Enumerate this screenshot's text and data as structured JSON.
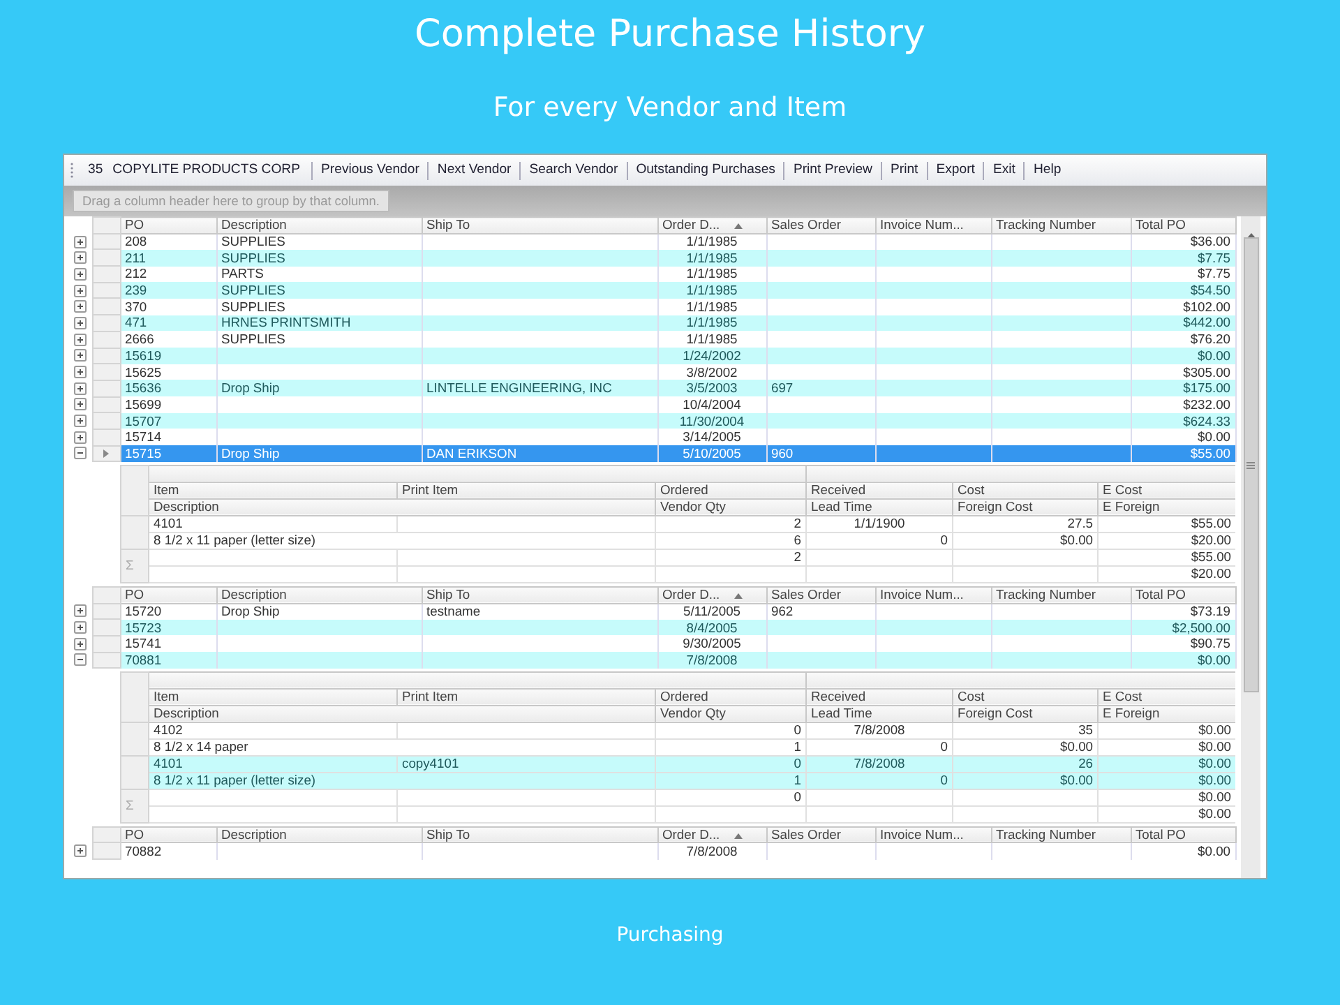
{
  "slide": {
    "title": "Complete Purchase History",
    "subtitle": "For every Vendor and Item",
    "footer": "Purchasing"
  },
  "toolbar": {
    "vendor_number": "35",
    "vendor_name": "COPYLITE PRODUCTS CORP",
    "buttons": [
      "Previous Vendor",
      "Next Vendor",
      "Search Vendor",
      "Outstanding Purchases",
      "Print Preview",
      "Print",
      "Export",
      "Exit",
      "Help"
    ]
  },
  "group_panel": {
    "placeholder": "Drag a column header here to group by that column."
  },
  "grid": {
    "blocks": [
      {
        "kind": "header",
        "columns": [
          {
            "label": "PO"
          },
          {
            "label": "Description"
          },
          {
            "label": "Ship To"
          },
          {
            "label": "Order D...",
            "sorted": true
          },
          {
            "label": "Sales Order"
          },
          {
            "label": "Invoice Num..."
          },
          {
            "label": "Tracking Number"
          },
          {
            "label": "Total PO"
          }
        ]
      },
      {
        "kind": "po",
        "po": "208",
        "description": "SUPPLIES",
        "order_date": "1/1/1985",
        "total": "$36.00",
        "expanded": false,
        "selected": false
      },
      {
        "kind": "po",
        "po": "211",
        "description": "SUPPLIES",
        "order_date": "1/1/1985",
        "total": "$7.75",
        "expanded": false,
        "selected": false
      },
      {
        "kind": "po",
        "po": "212",
        "description": "PARTS",
        "order_date": "1/1/1985",
        "total": "$7.75",
        "expanded": false,
        "selected": false
      },
      {
        "kind": "po",
        "po": "239",
        "description": "SUPPLIES",
        "order_date": "1/1/1985",
        "total": "$54.50",
        "expanded": false,
        "selected": false
      },
      {
        "kind": "po",
        "po": "370",
        "description": "SUPPLIES",
        "order_date": "1/1/1985",
        "total": "$102.00",
        "expanded": false,
        "selected": false
      },
      {
        "kind": "po",
        "po": "471",
        "description": "HRNES PRINTSMITH",
        "order_date": "1/1/1985",
        "total": "$442.00",
        "expanded": false,
        "selected": false
      },
      {
        "kind": "po",
        "po": "2666",
        "description": "SUPPLIES",
        "order_date": "1/1/1985",
        "total": "$76.20",
        "expanded": false,
        "selected": false
      },
      {
        "kind": "po",
        "po": "15619",
        "order_date": "1/24/2002",
        "total": "$0.00",
        "expanded": false,
        "selected": false
      },
      {
        "kind": "po",
        "po": "15625",
        "order_date": "3/8/2002",
        "total": "$305.00",
        "expanded": false,
        "selected": false
      },
      {
        "kind": "po",
        "po": "15636",
        "description": "Drop Ship",
        "ship_to": "LINTELLE ENGINEERING, INC",
        "order_date": "3/5/2003",
        "sales_order": "697",
        "total": "$175.00",
        "expanded": false,
        "selected": false
      },
      {
        "kind": "po",
        "po": "15699",
        "order_date": "10/4/2004",
        "total": "$232.00",
        "expanded": false,
        "selected": false
      },
      {
        "kind": "po",
        "po": "15707",
        "order_date": "11/30/2004",
        "total": "$624.33",
        "expanded": false,
        "selected": false
      },
      {
        "kind": "po",
        "po": "15714",
        "order_date": "3/14/2005",
        "total": "$0.00",
        "expanded": false,
        "selected": false
      },
      {
        "kind": "po",
        "po": "15715",
        "description": "Drop Ship",
        "ship_to": "DAN ERIKSON",
        "order_date": "5/10/2005",
        "sales_order": "960",
        "total": "$55.00",
        "expanded": true,
        "selected": true
      },
      {
        "kind": "detail",
        "columns_top": [
          "Item",
          "Print Item",
          "Ordered",
          "Received",
          "Cost",
          "E Cost"
        ],
        "columns_bottom": [
          "Description",
          "Vendor Qty",
          "Lead Time",
          "Foreign Cost",
          "E Foreign"
        ],
        "items": [
          {
            "item": "4101",
            "ordered": "2",
            "received": "1/1/1900",
            "cost": "27.5",
            "e_cost": "$55.00",
            "description": "8 1/2 x 11 paper (letter size)",
            "vendor_qty": "6",
            "lead_time": "0",
            "foreign_cost": "$0.00",
            "e_foreign": "$20.00"
          }
        ],
        "summary": {
          "symbol": "Σ",
          "ordered": "2",
          "e_cost": "$55.00",
          "e_foreign": "$20.00"
        }
      },
      {
        "kind": "header",
        "columns": [
          {
            "label": "PO"
          },
          {
            "label": "Description"
          },
          {
            "label": "Ship To"
          },
          {
            "label": "Order D...",
            "sorted": true
          },
          {
            "label": "Sales Order"
          },
          {
            "label": "Invoice Num..."
          },
          {
            "label": "Tracking Number"
          },
          {
            "label": "Total PO"
          }
        ]
      },
      {
        "kind": "po",
        "po": "15720",
        "description": "Drop Ship",
        "ship_to": "testname",
        "order_date": "5/11/2005",
        "sales_order": "962",
        "total": "$73.19",
        "expanded": false,
        "selected": false
      },
      {
        "kind": "po",
        "po": "15723",
        "order_date": "8/4/2005",
        "total": "$2,500.00",
        "expanded": false,
        "selected": false
      },
      {
        "kind": "po",
        "po": "15741",
        "order_date": "9/30/2005",
        "total": "$90.75",
        "expanded": false,
        "selected": false
      },
      {
        "kind": "po",
        "po": "70881",
        "order_date": "7/8/2008",
        "total": "$0.00",
        "expanded": true,
        "selected": false
      },
      {
        "kind": "detail",
        "columns_top": [
          "Item",
          "Print Item",
          "Ordered",
          "Received",
          "Cost",
          "E Cost"
        ],
        "columns_bottom": [
          "Description",
          "Vendor Qty",
          "Lead Time",
          "Foreign Cost",
          "E Foreign"
        ],
        "items": [
          {
            "item": "4102",
            "ordered": "0",
            "received": "7/8/2008",
            "cost": "35",
            "e_cost": "$0.00",
            "description": "8 1/2 x 14 paper",
            "vendor_qty": "1",
            "lead_time": "0",
            "foreign_cost": "$0.00",
            "e_foreign": "$0.00"
          },
          {
            "item": "4101",
            "print_item": "copy4101",
            "ordered": "0",
            "received": "7/8/2008",
            "cost": "26",
            "e_cost": "$0.00",
            "description": "8 1/2 x 11 paper (letter size)",
            "vendor_qty": "1",
            "lead_time": "0",
            "foreign_cost": "$0.00",
            "e_foreign": "$0.00"
          }
        ],
        "summary": {
          "symbol": "Σ",
          "ordered": "0",
          "e_cost": "$0.00",
          "e_foreign": "$0.00"
        }
      },
      {
        "kind": "header",
        "columns": [
          {
            "label": "PO"
          },
          {
            "label": "Description"
          },
          {
            "label": "Ship To"
          },
          {
            "label": "Order D...",
            "sorted": true
          },
          {
            "label": "Sales Order"
          },
          {
            "label": "Invoice Num..."
          },
          {
            "label": "Tracking Number"
          },
          {
            "label": "Total PO"
          }
        ]
      },
      {
        "kind": "po",
        "po": "70882",
        "order_date": "7/8/2008",
        "total": "$0.00",
        "expanded": false,
        "selected": false
      }
    ]
  }
}
